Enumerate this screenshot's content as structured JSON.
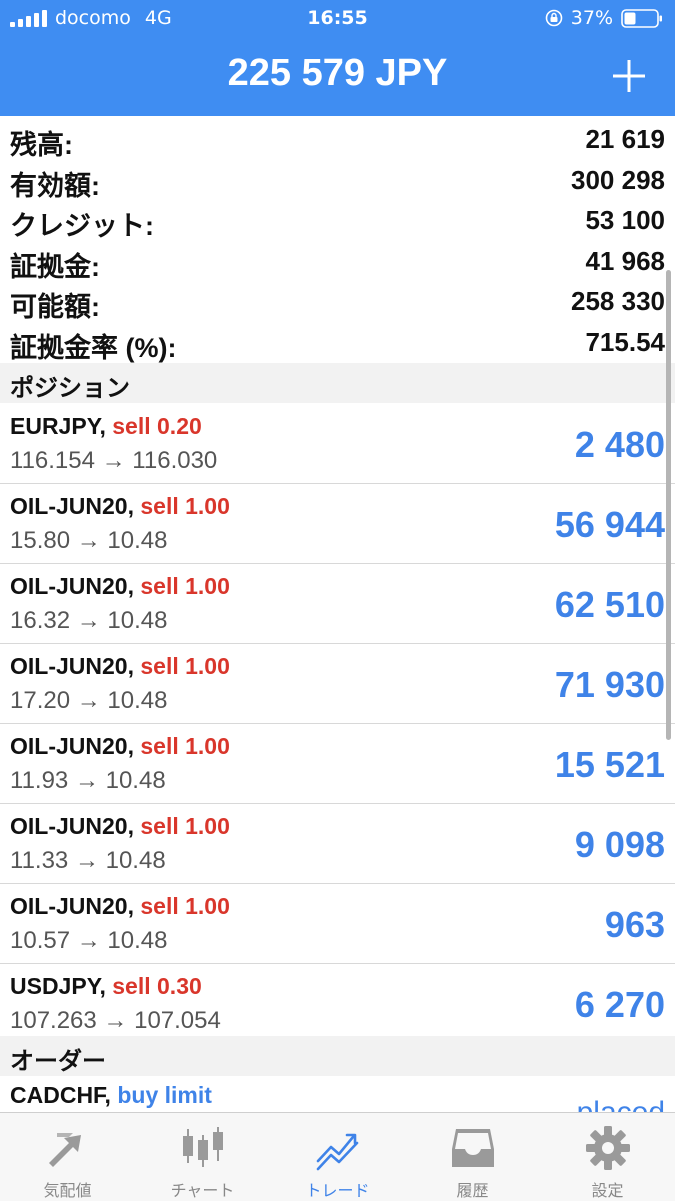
{
  "status_bar": {
    "carrier": "docomo",
    "network": "4G",
    "time": "16:55",
    "battery": "37%"
  },
  "header": {
    "balance": "225 579 JPY",
    "add_icon": "plus-icon"
  },
  "summary": [
    {
      "label": "残高:",
      "value": "21 619"
    },
    {
      "label": "有効額:",
      "value": "300 298"
    },
    {
      "label": "クレジット:",
      "value": "53 100"
    },
    {
      "label": "証拠金:",
      "value": "41 968"
    },
    {
      "label": "可能額:",
      "value": "258 330"
    },
    {
      "label": "証拠金率 (%):",
      "value": "715.54"
    }
  ],
  "positions_header": "ポジション",
  "positions": [
    {
      "symbol": "EURJPY,",
      "side": "sell 0.20",
      "prices": "116.154 → 116.030",
      "profit": "2 480"
    },
    {
      "symbol": "OIL-JUN20,",
      "side": "sell 1.00",
      "prices": "15.80 → 10.48",
      "profit": "56 944"
    },
    {
      "symbol": "OIL-JUN20,",
      "side": "sell 1.00",
      "prices": "16.32 → 10.48",
      "profit": "62 510"
    },
    {
      "symbol": "OIL-JUN20,",
      "side": "sell 1.00",
      "prices": "17.20 → 10.48",
      "profit": "71 930"
    },
    {
      "symbol": "OIL-JUN20,",
      "side": "sell 1.00",
      "prices": "11.93 → 10.48",
      "profit": "15 521"
    },
    {
      "symbol": "OIL-JUN20,",
      "side": "sell 1.00",
      "prices": "11.33 → 10.48",
      "profit": "9 098"
    },
    {
      "symbol": "OIL-JUN20,",
      "side": "sell 1.00",
      "prices": "10.57 → 10.48",
      "profit": "963"
    },
    {
      "symbol": "USDJPY,",
      "side": "sell 0.30",
      "prices": "107.263 → 107.054",
      "profit": "6 270"
    }
  ],
  "orders_header": "オーダー",
  "orders": [
    {
      "symbol": "CADCHF,",
      "type": "buy limit",
      "state": "placed"
    }
  ],
  "tabs": [
    {
      "label": "気配値",
      "icon": "quotes-arrows-icon",
      "active": false
    },
    {
      "label": "チャート",
      "icon": "candlestick-chart-icon",
      "active": false
    },
    {
      "label": "トレード",
      "icon": "trade-trend-icon",
      "active": true
    },
    {
      "label": "履歴",
      "icon": "history-tray-icon",
      "active": false
    },
    {
      "label": "設定",
      "icon": "gear-icon",
      "active": false
    }
  ],
  "colors": {
    "accent": "#3f8df2",
    "sell": "#d9362b",
    "profit": "#3f83e8",
    "tab_inactive": "#888888"
  }
}
